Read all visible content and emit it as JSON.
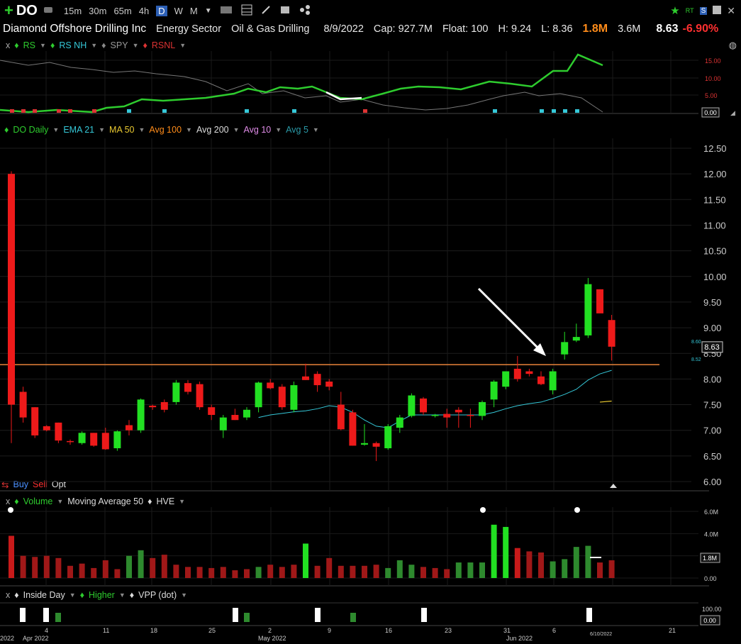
{
  "toolbar": {
    "symbol": "DO",
    "timeframes": [
      "15m",
      "30m",
      "65m",
      "4h",
      "D",
      "W",
      "M"
    ],
    "selected_timeframe": "D"
  },
  "info": {
    "company": "Diamond Offshore Drilling Inc",
    "sector": "Energy Sector",
    "industry": "Oil & Gas Drilling",
    "date": "8/9/2022",
    "cap": "Cap: 927.7M",
    "float": "Float: 100",
    "high": "H: 9.24",
    "low": "L: 8.36",
    "volume": "1.8M",
    "avg_volume": "3.6M",
    "last": "8.63",
    "change": "-6.90%"
  },
  "rs_legend": [
    "RS",
    "RS NH",
    "SPY",
    "RSNL"
  ],
  "rs_axis": {
    "ticks": [
      "15.00",
      "10.00",
      "5.00"
    ],
    "current": "0.00"
  },
  "price_legend": [
    "DO Daily",
    "EMA 21",
    "MA 50",
    "Avg 100",
    "Avg 200",
    "Avg 10",
    "Avg 5"
  ],
  "price_axis": {
    "ticks": [
      "12.50",
      "12.00",
      "11.50",
      "11.00",
      "10.50",
      "10.00",
      "9.50",
      "9.00",
      "8.50",
      "8.00",
      "7.50",
      "7.00",
      "6.50",
      "6.00"
    ],
    "current": "8.63",
    "hi_label": "8.60",
    "lo_label": "8.52"
  },
  "trade_buttons": {
    "buy": "Buy",
    "sell": "Sell",
    "opt": "Opt"
  },
  "volume_legend": [
    "Volume",
    "Moving Average 50",
    "HVE"
  ],
  "volume_axis": {
    "ticks": [
      "6.0M",
      "4.0M",
      "2.0M",
      "0.00"
    ],
    "current": "1.8M"
  },
  "pattern_legend": [
    "Inside Day",
    "Higher",
    "VPP (dot)"
  ],
  "pattern_axis": {
    "ticks": [
      "100.00",
      "0.00"
    ]
  },
  "date_axis": {
    "labels": [
      "2022",
      "Apr 2022",
      "4",
      "11",
      "18",
      "25",
      "May 2022",
      "2",
      "9",
      "16",
      "23",
      "31",
      "Jun 2022",
      "6",
      "6/10/2022",
      "21"
    ]
  },
  "chart_data": {
    "type": "candlestick",
    "title": "DO Daily",
    "ylim": [
      6.0,
      12.5
    ],
    "resistance_level": 8.28,
    "candles": [
      {
        "o": 12.0,
        "h": 12.05,
        "l": 6.75,
        "c": 7.5
      },
      {
        "o": 7.75,
        "h": 7.85,
        "l": 7.15,
        "c": 7.25
      },
      {
        "o": 7.45,
        "h": 7.45,
        "l": 6.85,
        "c": 6.9
      },
      {
        "o": 7.08,
        "h": 7.1,
        "l": 6.98,
        "c": 7.0
      },
      {
        "o": 7.15,
        "h": 7.15,
        "l": 6.75,
        "c": 6.8
      },
      {
        "o": 6.79,
        "h": 6.82,
        "l": 6.72,
        "c": 6.78
      },
      {
        "o": 6.75,
        "h": 6.98,
        "l": 6.72,
        "c": 6.95
      },
      {
        "o": 6.95,
        "h": 6.95,
        "l": 6.68,
        "c": 6.7
      },
      {
        "o": 6.95,
        "h": 7.05,
        "l": 6.62,
        "c": 6.63
      },
      {
        "o": 6.65,
        "h": 7.0,
        "l": 6.6,
        "c": 6.98
      },
      {
        "o": 7.1,
        "h": 7.2,
        "l": 6.9,
        "c": 7.0
      },
      {
        "o": 7.0,
        "h": 7.62,
        "l": 6.95,
        "c": 7.6
      },
      {
        "o": 7.48,
        "h": 7.5,
        "l": 7.4,
        "c": 7.45
      },
      {
        "o": 7.55,
        "h": 7.6,
        "l": 7.35,
        "c": 7.4
      },
      {
        "o": 7.55,
        "h": 7.98,
        "l": 7.5,
        "c": 7.93
      },
      {
        "o": 7.92,
        "h": 7.98,
        "l": 7.7,
        "c": 7.75
      },
      {
        "o": 7.9,
        "h": 7.95,
        "l": 7.4,
        "c": 7.45
      },
      {
        "o": 7.45,
        "h": 7.5,
        "l": 7.2,
        "c": 7.3
      },
      {
        "o": 7.0,
        "h": 7.3,
        "l": 6.85,
        "c": 7.25
      },
      {
        "o": 7.3,
        "h": 7.42,
        "l": 7.2,
        "c": 7.2
      },
      {
        "o": 7.25,
        "h": 7.45,
        "l": 7.2,
        "c": 7.4
      },
      {
        "o": 7.45,
        "h": 7.95,
        "l": 7.35,
        "c": 7.93
      },
      {
        "o": 7.93,
        "h": 8.0,
        "l": 7.8,
        "c": 7.82
      },
      {
        "o": 7.85,
        "h": 7.9,
        "l": 7.4,
        "c": 7.45
      },
      {
        "o": 7.4,
        "h": 7.95,
        "l": 7.35,
        "c": 7.88
      },
      {
        "o": 8.05,
        "h": 8.3,
        "l": 7.98,
        "c": 7.98
      },
      {
        "o": 8.1,
        "h": 8.15,
        "l": 7.75,
        "c": 7.88
      },
      {
        "o": 7.95,
        "h": 8.0,
        "l": 7.78,
        "c": 7.85
      },
      {
        "o": 7.5,
        "h": 7.75,
        "l": 7.0,
        "c": 7.02
      },
      {
        "o": 7.35,
        "h": 7.4,
        "l": 6.7,
        "c": 6.7
      },
      {
        "o": 6.72,
        "h": 7.12,
        "l": 6.7,
        "c": 6.75
      },
      {
        "o": 6.75,
        "h": 6.78,
        "l": 6.4,
        "c": 6.68
      },
      {
        "o": 6.65,
        "h": 7.12,
        "l": 6.62,
        "c": 7.08
      },
      {
        "o": 7.05,
        "h": 7.3,
        "l": 6.95,
        "c": 7.25
      },
      {
        "o": 7.28,
        "h": 7.72,
        "l": 7.25,
        "c": 7.68
      },
      {
        "o": 7.62,
        "h": 7.65,
        "l": 7.3,
        "c": 7.35
      },
      {
        "o": 7.28,
        "h": 7.32,
        "l": 7.25,
        "c": 7.3
      },
      {
        "o": 7.32,
        "h": 7.42,
        "l": 7.05,
        "c": 7.25
      },
      {
        "o": 7.4,
        "h": 7.45,
        "l": 7.05,
        "c": 7.35
      },
      {
        "o": 7.3,
        "h": 7.42,
        "l": 7.05,
        "c": 7.28
      },
      {
        "o": 7.28,
        "h": 7.58,
        "l": 7.2,
        "c": 7.55
      },
      {
        "o": 7.6,
        "h": 7.98,
        "l": 7.45,
        "c": 7.95
      },
      {
        "o": 7.85,
        "h": 8.15,
        "l": 7.8,
        "c": 8.15
      },
      {
        "o": 8.2,
        "h": 8.45,
        "l": 7.95,
        "c": 8.0
      },
      {
        "o": 8.15,
        "h": 8.2,
        "l": 8.05,
        "c": 8.1
      },
      {
        "o": 8.05,
        "h": 8.15,
        "l": 7.88,
        "c": 7.9
      },
      {
        "o": 7.78,
        "h": 8.2,
        "l": 7.7,
        "c": 8.15
      },
      {
        "o": 8.48,
        "h": 8.92,
        "l": 8.38,
        "c": 8.72
      },
      {
        "o": 8.75,
        "h": 9.08,
        "l": 8.72,
        "c": 8.82
      },
      {
        "o": 8.85,
        "h": 9.97,
        "l": 8.8,
        "c": 9.85
      },
      {
        "o": 9.75,
        "h": 9.75,
        "l": 9.3,
        "c": 9.28
      },
      {
        "o": 9.15,
        "h": 9.25,
        "l": 8.36,
        "c": 8.63
      }
    ],
    "ema21": [
      null,
      null,
      null,
      null,
      null,
      null,
      null,
      null,
      null,
      null,
      null,
      null,
      null,
      null,
      null,
      null,
      null,
      null,
      null,
      null,
      null,
      7.25,
      7.3,
      7.33,
      7.36,
      7.38,
      7.42,
      7.48,
      7.45,
      7.35,
      7.2,
      7.08,
      7.05,
      7.18,
      7.3,
      7.3,
      7.3,
      7.3,
      7.3,
      7.3,
      7.3,
      7.35,
      7.42,
      7.48,
      7.52,
      7.55,
      7.62,
      7.7,
      7.8,
      7.98,
      8.1,
      8.17
    ],
    "ma50_points": [
      {
        "i": 50,
        "v": 7.55
      },
      {
        "i": 51,
        "v": 7.57
      }
    ],
    "volume": [
      3.8,
      2.0,
      1.9,
      2.0,
      1.8,
      1.1,
      1.3,
      0.9,
      1.6,
      0.8,
      2.0,
      2.5,
      1.8,
      2.1,
      1.2,
      1.0,
      1.0,
      0.9,
      1.0,
      0.7,
      0.8,
      1.0,
      1.2,
      1.0,
      1.2,
      3.1,
      1.1,
      1.8,
      1.1,
      1.1,
      1.1,
      1.2,
      0.9,
      1.6,
      1.2,
      1.0,
      0.9,
      0.8,
      1.4,
      1.4,
      1.4,
      4.8,
      4.6,
      2.7,
      2.4,
      2.3,
      1.5,
      1.7,
      2.8,
      2.9,
      1.4,
      1.6
    ],
    "volume_up": [
      false,
      false,
      false,
      false,
      false,
      false,
      false,
      false,
      false,
      false,
      true,
      true,
      false,
      false,
      false,
      false,
      false,
      false,
      false,
      false,
      false,
      true,
      false,
      false,
      false,
      true,
      false,
      false,
      false,
      false,
      false,
      false,
      true,
      true,
      true,
      false,
      false,
      false,
      true,
      true,
      true,
      true,
      true,
      false,
      false,
      false,
      true,
      true,
      true,
      true,
      false,
      false
    ]
  }
}
